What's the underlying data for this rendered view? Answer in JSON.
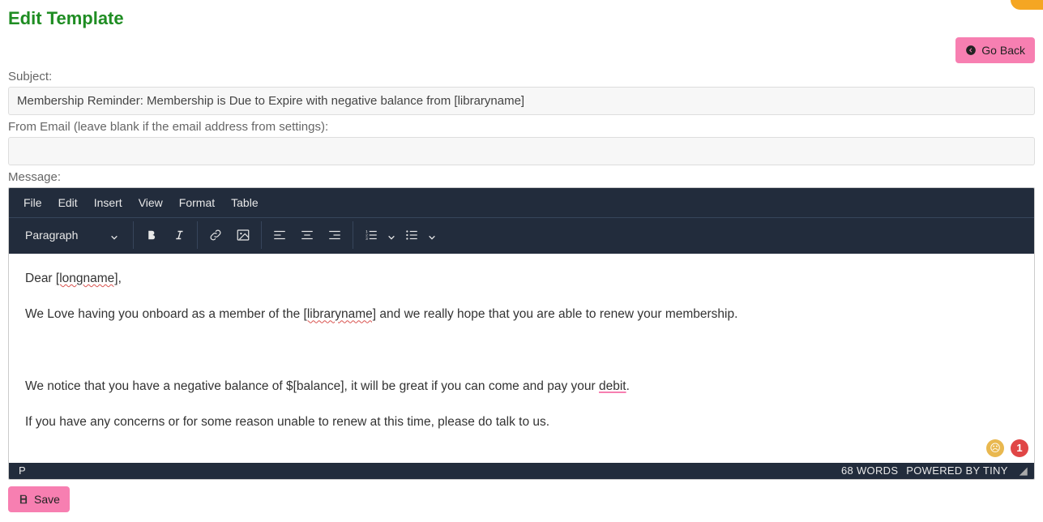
{
  "page": {
    "title": "Edit Template"
  },
  "buttons": {
    "go_back": "Go Back",
    "save": "Save"
  },
  "labels": {
    "subject": "Subject:",
    "from_email": "From Email (leave blank if the email address from settings):",
    "message": "Message:"
  },
  "fields": {
    "subject_value": "Membership Reminder: Membership is Due to Expire with negative balance from [libraryname]",
    "from_email_value": ""
  },
  "editor": {
    "menus": [
      "File",
      "Edit",
      "Insert",
      "View",
      "Format",
      "Table"
    ],
    "format_select": "Paragraph",
    "body": {
      "greeting_prefix": "Dear ",
      "greeting_token": "[longname]",
      "greeting_suffix": ",",
      "line2_a": "We Love having you onboard as a member of the ",
      "line2_token": "[libraryname]",
      "line2_b": " and we really hope that you are able to renew your membership.",
      "line3_a": "We notice that you have a negative balance of $[balance], it will be great if you can come and pay your ",
      "line3_debit": "debit",
      "line3_b": ".",
      "line4": "If you have any concerns or for some reason unable to renew at this time, please do talk to us."
    },
    "status_path": "P",
    "words_label": "68 WORDS",
    "powered_by": "POWERED BY TINY",
    "issue_count": "1"
  }
}
